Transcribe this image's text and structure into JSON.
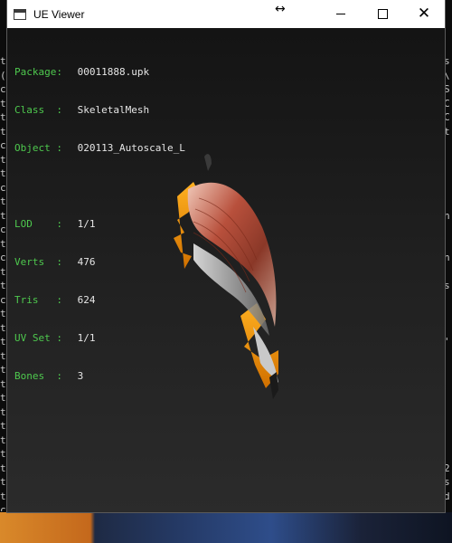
{
  "window": {
    "title": "UE Viewer",
    "minimize_icon": "minimize-icon",
    "maximize_icon": "maximize-icon",
    "close_icon": "close-icon"
  },
  "info": {
    "package_label": "Package:",
    "package_value": "00011888.upk",
    "class_label": "Class  :",
    "class_value": "SkeletalMesh",
    "object_label": "Object :",
    "object_value": "020113_Autoscale_L",
    "lod_label": "LOD    :",
    "lod_value": "1/1",
    "verts_label": "Verts  :",
    "verts_value": "476",
    "tris_label": "Tris   :",
    "tris_value": "624",
    "uvset_label": "UV Set :",
    "uvset_value": "1/1",
    "bones_label": "Bones  :",
    "bones_value": "3"
  },
  "background_console": {
    "left_chars": "t\n(\nc\nt\nt\nt\nc\nt\nt\nc\nt\nt\nc\nt\nc\nt\nt\nc\nt\nt\nt\nt\nt\nt\nt\nt\nt\nt\nt\nt\nt\nt\nc",
    "right_chars": "s\n\\\nS\nC\nC\nt\n\n\n\n\n\nn\n\n\nn\n\ns\n\n\n\n'\n\n\n\n\n\n\n\n\n2\ns\nd\n"
  },
  "colors": {
    "label_green": "#4ec94e",
    "value_white": "#e6e6e6",
    "viewport_bg": "#202020"
  }
}
